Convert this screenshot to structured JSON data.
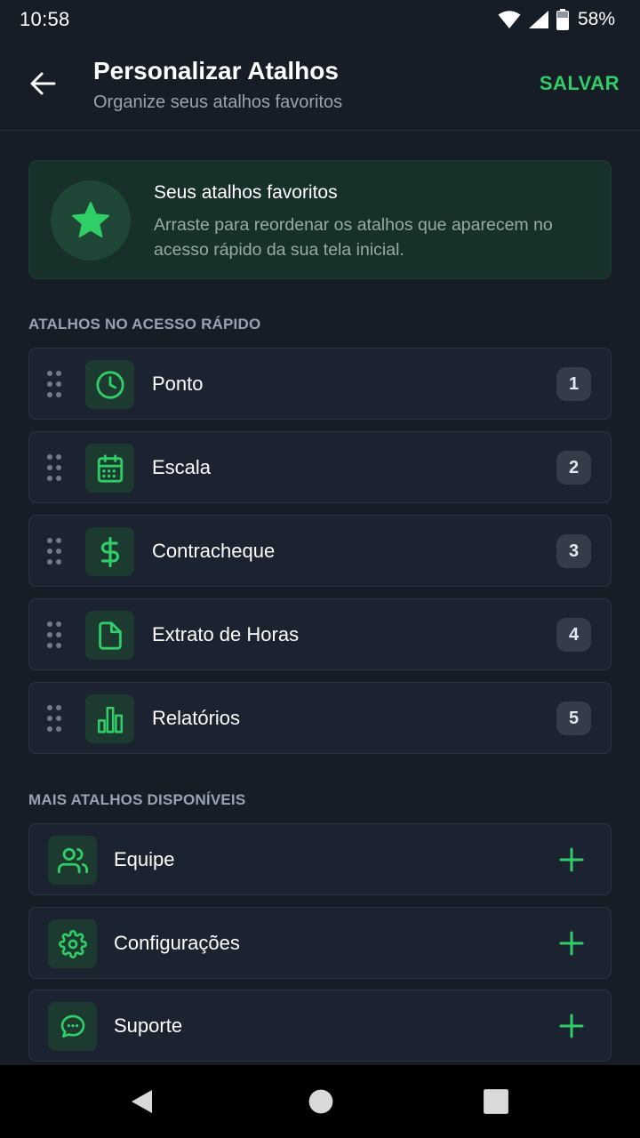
{
  "status_bar": {
    "time": "10:58",
    "battery": "58%"
  },
  "header": {
    "title": "Personalizar Atalhos",
    "subtitle": "Organize seus atalhos favoritos",
    "save_label": "SALVAR"
  },
  "info_card": {
    "title": "Seus atalhos favoritos",
    "description": "Arraste para reordenar os atalhos que aparecem no acesso rápido da sua tela inicial.",
    "icon": "star-icon"
  },
  "quick_access": {
    "section_title": "ATALHOS NO ACESSO RÁPIDO",
    "items": [
      {
        "label": "Ponto",
        "order": "1",
        "icon": "clock-icon"
      },
      {
        "label": "Escala",
        "order": "2",
        "icon": "calendar-icon"
      },
      {
        "label": "Contracheque",
        "order": "3",
        "icon": "dollar-icon"
      },
      {
        "label": "Extrato de Horas",
        "order": "4",
        "icon": "file-icon"
      },
      {
        "label": "Relatórios",
        "order": "5",
        "icon": "bar-chart-icon"
      }
    ]
  },
  "more_shortcuts": {
    "section_title": "MAIS ATALHOS DISPONÍVEIS",
    "items": [
      {
        "label": "Equipe",
        "icon": "users-icon"
      },
      {
        "label": "Configurações",
        "icon": "gear-icon"
      },
      {
        "label": "Suporte",
        "icon": "chat-icon"
      }
    ]
  },
  "colors": {
    "background": "#161d27",
    "accent": "#2fce67",
    "card": "#1c2330",
    "icon_box": "#1d3a31"
  }
}
